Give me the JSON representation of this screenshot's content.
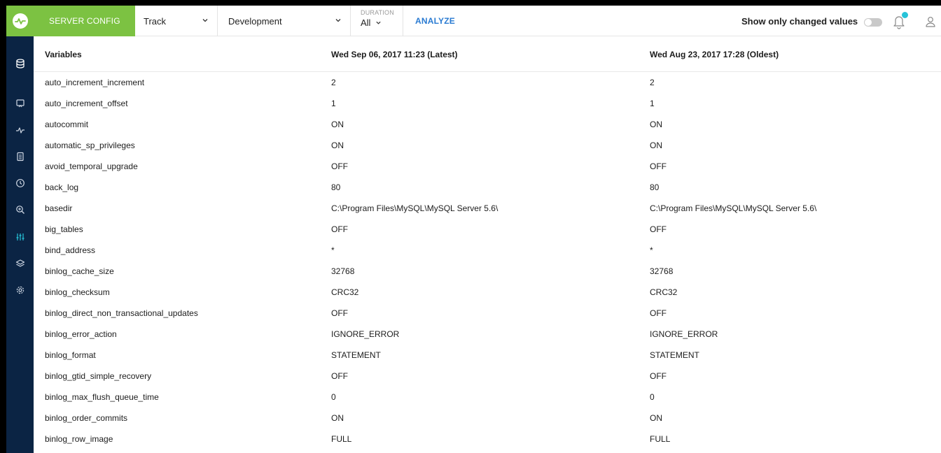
{
  "header": {
    "section_title": "SERVER CONFIG",
    "track_dropdown": "Track",
    "environment_dropdown": "Development",
    "duration": {
      "label": "DURATION",
      "value": "All"
    },
    "analyze_link": "ANALYZE",
    "changed_toggle_label": "Show only changed values",
    "changed_toggle_on": false
  },
  "colors": {
    "brand_green": "#7cc242",
    "sidebar_navy": "#0b2444",
    "link_blue": "#2a7bd2",
    "notification_dot": "#27c3d8"
  },
  "sidebar": {
    "items": [
      {
        "icon": "database-icon"
      },
      {
        "icon": "monitor-icon"
      },
      {
        "icon": "activity-icon"
      },
      {
        "icon": "document-icon"
      },
      {
        "icon": "clock-icon"
      },
      {
        "icon": "search-zoom-icon"
      },
      {
        "icon": "sliders-icon",
        "active": true
      },
      {
        "icon": "layers-icon"
      },
      {
        "icon": "gear-icon"
      }
    ]
  },
  "table": {
    "headers": [
      "Variables",
      "Wed Sep 06, 2017 11:23 (Latest)",
      "Wed Aug 23, 2017 17:28 (Oldest)"
    ],
    "rows": [
      [
        "auto_increment_increment",
        "2",
        "2"
      ],
      [
        "auto_increment_offset",
        "1",
        "1"
      ],
      [
        "autocommit",
        "ON",
        "ON"
      ],
      [
        "automatic_sp_privileges",
        "ON",
        "ON"
      ],
      [
        "avoid_temporal_upgrade",
        "OFF",
        "OFF"
      ],
      [
        "back_log",
        "80",
        "80"
      ],
      [
        "basedir",
        "C:\\Program Files\\MySQL\\MySQL Server 5.6\\",
        "C:\\Program Files\\MySQL\\MySQL Server 5.6\\"
      ],
      [
        "big_tables",
        "OFF",
        "OFF"
      ],
      [
        "bind_address",
        "*",
        "*"
      ],
      [
        "binlog_cache_size",
        "32768",
        "32768"
      ],
      [
        "binlog_checksum",
        "CRC32",
        "CRC32"
      ],
      [
        "binlog_direct_non_transactional_updates",
        "OFF",
        "OFF"
      ],
      [
        "binlog_error_action",
        "IGNORE_ERROR",
        "IGNORE_ERROR"
      ],
      [
        "binlog_format",
        "STATEMENT",
        "STATEMENT"
      ],
      [
        "binlog_gtid_simple_recovery",
        "OFF",
        "OFF"
      ],
      [
        "binlog_max_flush_queue_time",
        "0",
        "0"
      ],
      [
        "binlog_order_commits",
        "ON",
        "ON"
      ],
      [
        "binlog_row_image",
        "FULL",
        "FULL"
      ]
    ]
  }
}
